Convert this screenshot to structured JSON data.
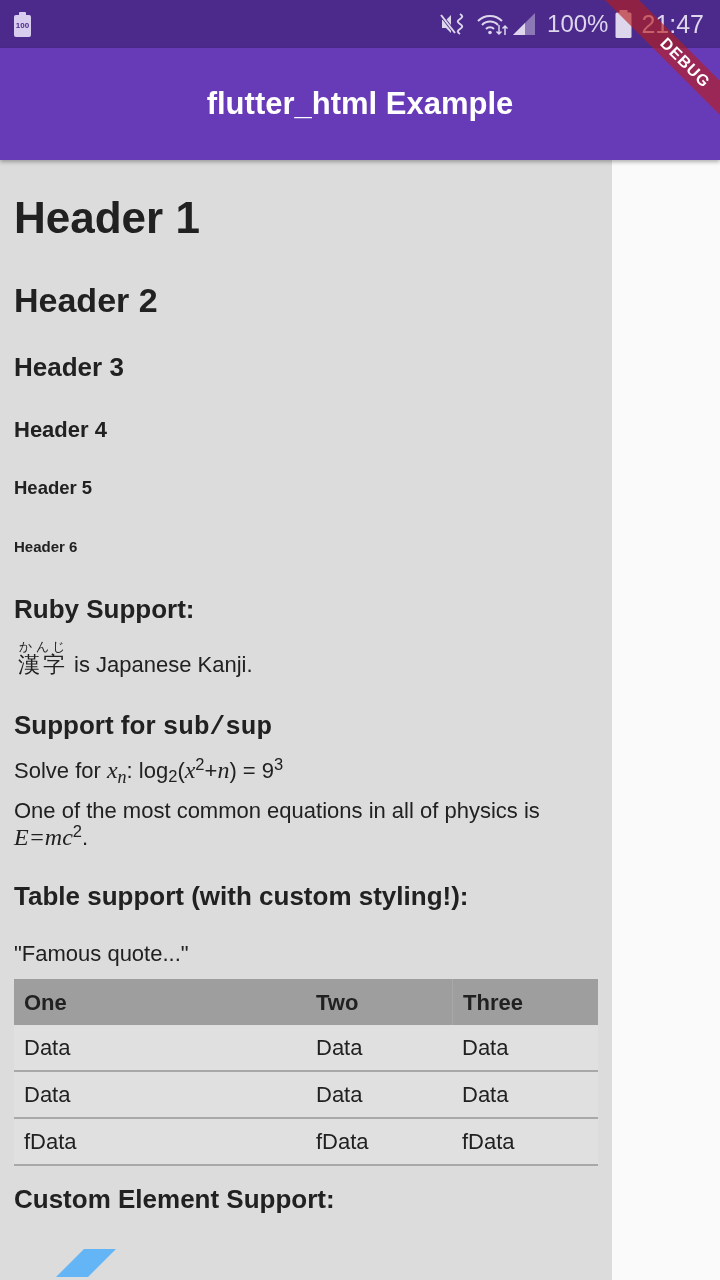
{
  "status_bar": {
    "notification_badge": "100",
    "battery_percent": "100%",
    "time": "21:47"
  },
  "app_bar": {
    "title": "flutter_html Example"
  },
  "debug_banner": {
    "label": "DEBUG"
  },
  "content": [
    {
      "kind": "h1",
      "text": "Header 1"
    },
    {
      "kind": "h2",
      "text": "Header 2"
    },
    {
      "kind": "h3",
      "text": "Header 3"
    },
    {
      "kind": "h4",
      "text": "Header 4"
    },
    {
      "kind": "h5",
      "text": "Header 5"
    },
    {
      "kind": "h6",
      "text": "Header 6"
    },
    {
      "kind": "h3",
      "text": "Ruby Support:"
    },
    {
      "kind": "ruby",
      "base": "漢字",
      "annotation": "かんじ",
      "text": "is Japanese Kanji."
    },
    {
      "kind": "h3",
      "runs": [
        {
          "kind": "plain",
          "text": "Support for "
        },
        {
          "kind": "code",
          "text": "sub/sup"
        }
      ]
    },
    {
      "kind": "paragraph",
      "text": "Solve for *x$_{n}$*: log$_{2}$(*x*$^{2}$+*n*) = 9$^{3}$"
    },
    {
      "kind": "paragraph",
      "text": "One of the most common equations in all of physics is *E=mc*$^{2}$."
    },
    {
      "kind": "h3",
      "text": "Table support (with custom styling!):"
    },
    {
      "kind": "quote",
      "text": "\"Famous quote...\""
    },
    {
      "kind": "table",
      "columns": [
        "One",
        "Two",
        "Three"
      ],
      "rows": [
        [
          "Data",
          "Data",
          "Data"
        ],
        [
          "Data",
          "Data",
          "Data"
        ],
        [
          "fData",
          "fData",
          "fData"
        ]
      ]
    },
    {
      "kind": "h3",
      "text": "Custom Element Support:"
    },
    {
      "kind": "logo"
    }
  ]
}
